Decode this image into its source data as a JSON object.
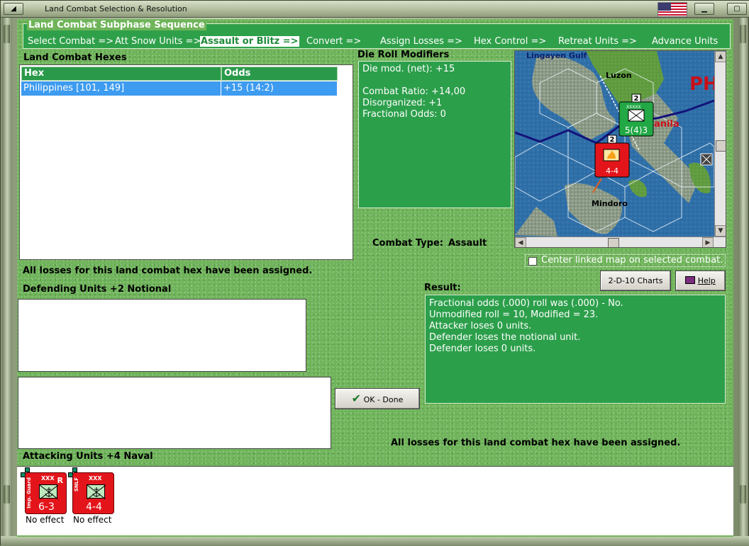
{
  "window": {
    "title": "Land Combat Selection & Resolution"
  },
  "sequence": {
    "title": "Land Combat Subphase Sequence",
    "steps": [
      "Select Combat =>",
      "Att Snow Units =>",
      "Assault or Blitz =>",
      "Convert =>",
      "Assign Losses =>",
      "Hex Control =>",
      "Retreat Units =>",
      "Advance Units"
    ],
    "active_index": 2
  },
  "hexes": {
    "title": "Land Combat Hexes",
    "columns": [
      "Hex",
      "Odds"
    ],
    "rows": [
      {
        "hex": "Philippines [101, 149]",
        "odds": "+15 (14:2)"
      }
    ]
  },
  "drm": {
    "title": "Die Roll Modifiers",
    "lines": [
      "Die mod. (net): +15",
      "",
      "Combat Ratio: +14,00",
      "Disorganized: +1",
      "Fractional Odds: 0"
    ]
  },
  "map": {
    "labels": {
      "gulf": "Lingayen Gulf",
      "luzon": "Luzon",
      "manila": "anila",
      "mindoro": "Mindoro",
      "ph": "PH"
    },
    "units": {
      "defender": {
        "stack": "2",
        "size": "XXXXX",
        "strength": "5(4)3"
      },
      "attacker": {
        "stack": "2",
        "strength": "4-4"
      }
    }
  },
  "combat_type": {
    "label": "Combat Type:",
    "value": "Assault"
  },
  "center_linked": {
    "label": "Center linked map on selected combat.",
    "checked": false
  },
  "losses_msg": "All losses for this land combat hex have been assigned.",
  "buttons": {
    "charts": "2-D-10 Charts",
    "help": "Help",
    "ok": "OK - Done"
  },
  "defending": {
    "title": "Defending Units +2 Notional"
  },
  "result": {
    "title": "Result:",
    "lines": [
      "Fractional odds (.000) roll was (.000)  - No.",
      "Unmodified roll = 10, Modified = 23.",
      "Attacker loses 0 units.",
      "Defender loses the notional unit.",
      "Defender loses 0 units."
    ]
  },
  "attacking": {
    "title": "Attacking Units +4 Naval",
    "units": [
      {
        "class": "XXX",
        "side_text": "Imp. Guard",
        "marker": "R",
        "strength": "6-3",
        "status": "No effect"
      },
      {
        "class": "XXX",
        "side_text": "SNLF",
        "marker": "",
        "strength": "4-4",
        "status": "No effect"
      }
    ]
  },
  "colors": {
    "panel_green": "#2c9f4b",
    "felt_green": "#6fb45a",
    "selection_blue": "#3d9bf0",
    "counter_red": "#e3151b"
  }
}
